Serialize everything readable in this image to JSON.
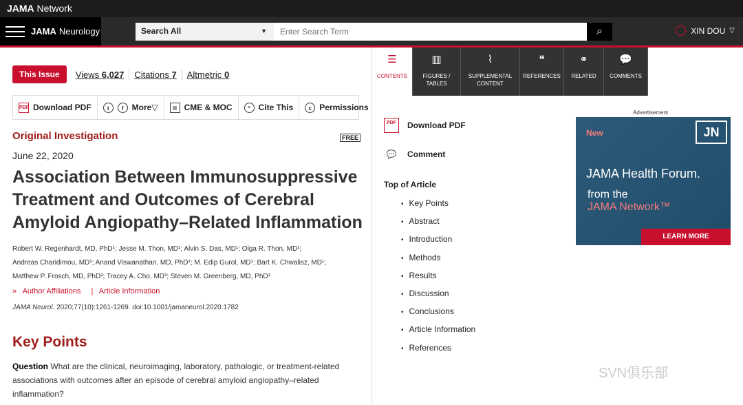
{
  "topbar": {
    "network": "JAMA",
    "network_suffix": " Network"
  },
  "header": {
    "journal_bold": "JAMA",
    "journal_name": "Neurology",
    "search_scope": "Search All",
    "search_placeholder": "Enter Search Term",
    "user_name": "XIN DOU"
  },
  "stats": {
    "badge": "This Issue",
    "views_label": "Views",
    "views": "6,027",
    "citations_label": "Citations",
    "citations": "7",
    "altmetric_label": "Altmetric",
    "altmetric": "0"
  },
  "toolbar": {
    "download_pdf": "Download PDF",
    "more": "More",
    "cme": "CME & MOC",
    "cite": "Cite This",
    "permissions": "Permissions"
  },
  "article": {
    "type": "Original Investigation",
    "free": "FREE",
    "date": "June 22, 2020",
    "title": "Association Between Immunosuppressive Treatment and Outcomes of Cerebral Amyloid Angiopathy–Related Inflammation",
    "authors": [
      "Robert W. Regenhardt, MD, PhD¹; Jesse M. Thon, MD¹; Alvin S. Das, MD¹; Olga R. Thon, MD¹;",
      "Andreas Charidimou, MD¹; Anand Viswanathan, MD, PhD¹; M. Edip Gurol, MD¹; Bart K. Chwalisz, MD¹;",
      "Matthew P. Frosch, MD, PhD²; Tracey A. Cho, MD³; Steven M. Greenberg, MD, PhD¹"
    ],
    "author_affiliations": "Author Affiliations",
    "article_information": "Article Information",
    "citation_journal": "JAMA Neurol",
    "citation_rest": ". 2020;77(10):1261-1269. doi:10.1001/jamaneurol.2020.1782",
    "key_points_heading": "Key Points",
    "question_label": "Question",
    "question_text": "  What are the clinical, neuroimaging, laboratory, pathologic, or treatment-related associations with outcomes after an episode of cerebral amyloid angiopathy–related inflammation?"
  },
  "tabs": [
    {
      "label": "CONTENTS",
      "icon": "list-icon"
    },
    {
      "label": "FIGURES / TABLES",
      "icon": "chart-icon"
    },
    {
      "label": "SUPPLEMENTAL CONTENT",
      "icon": "paperclip-icon"
    },
    {
      "label": "REFERENCES",
      "icon": "quote-icon"
    },
    {
      "label": "RELATED",
      "icon": "link-icon"
    },
    {
      "label": "COMMENTS",
      "icon": "comment-icon"
    }
  ],
  "side": {
    "download_pdf": "Download PDF",
    "comment": "Comment",
    "toc_heading": "Top of Article",
    "toc": [
      "Key Points",
      "Abstract",
      "Introduction",
      "Methods",
      "Results",
      "Discussion",
      "Conclusions",
      "Article Information",
      "References"
    ]
  },
  "ad": {
    "label": "Advertisement",
    "logo": "JN",
    "new": "New",
    "title": "JAMA Health Forum.",
    "from": "from the",
    "network": "JAMA Network™",
    "cta": "LEARN MORE"
  },
  "watermark": "SVN俱乐部",
  "colors": {
    "accent": "#c8102e",
    "heading": "#a01b1b",
    "dark_bar": "#2a2a2a"
  }
}
